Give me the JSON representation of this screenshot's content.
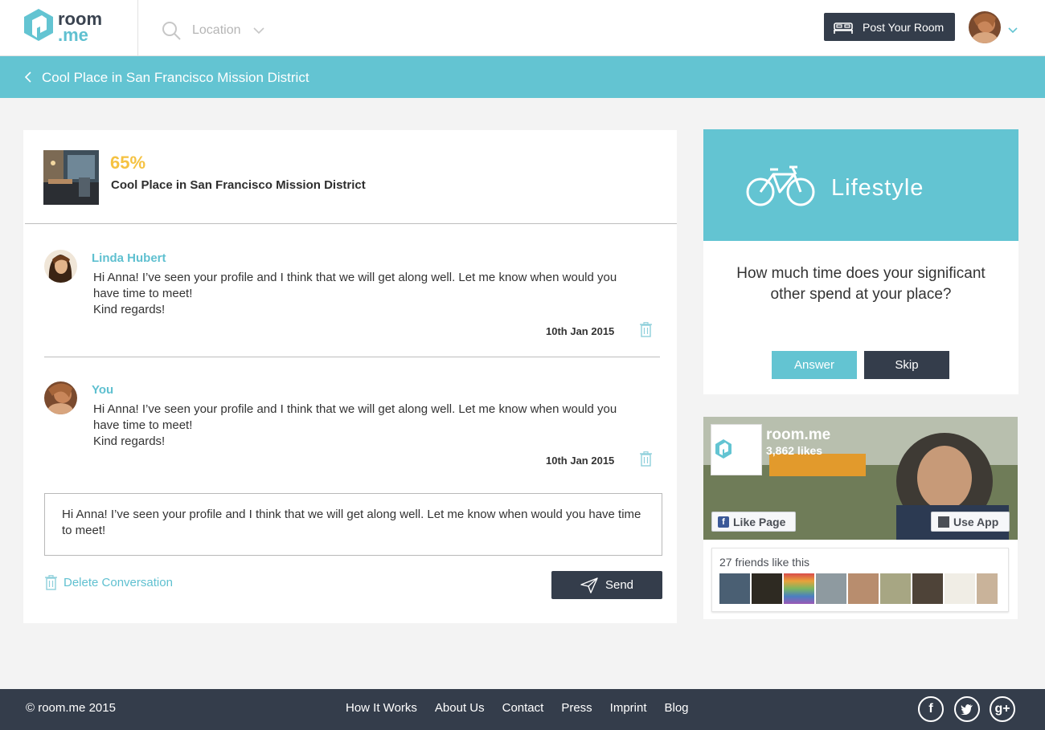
{
  "colors": {
    "accent": "#63c4d2",
    "dark": "#343d4b",
    "percent": "#f5c242",
    "background": "#f3f3f3"
  },
  "header": {
    "logo_top": "room",
    "logo_bottom": ".me",
    "location_placeholder": "Location",
    "post_room_label": "Post Your Room",
    "icons": {
      "search": "search-icon",
      "location_chevron": "chevron-down-icon",
      "post": "bed-icon",
      "avatar_chevron": "chevron-down-icon"
    }
  },
  "subbar": {
    "title": "Cool Place in San Francisco Mission District",
    "back_icon": "chevron-left-icon"
  },
  "room": {
    "percent": "65%",
    "name": "Cool Place in San Francisco Mission District"
  },
  "messages": [
    {
      "author": "Linda Hubert",
      "line1": "Hi Anna! I’ve seen your profile and I think that we will get along well. Let me know when would you",
      "line2": "have time to meet!",
      "line3": "Kind regards!",
      "date": "10th Jan 2015"
    },
    {
      "author": "You",
      "line1": "Hi Anna! I’ve seen your profile and I think that we will get along well. Let me know when would you",
      "line2": "have time to meet!",
      "line3": "Kind regards!",
      "date": "10th Jan 2015"
    }
  ],
  "reply": {
    "text": "Hi Anna! I’ve seen your profile and I think that we will get along well. Let me know when would you have time to meet!"
  },
  "actions": {
    "delete_label": "Delete Conversation",
    "send_label": "Send"
  },
  "lifestyle": {
    "title": "Lifestyle",
    "question": "How much time does your significant other spend at your place?",
    "answer_label": "Answer",
    "skip_label": "Skip",
    "icon": "bicycle-icon"
  },
  "facebook": {
    "page_name": "room.me",
    "likes": "3,862 likes",
    "logo_top": "room",
    "logo_bottom": ".me",
    "like_label": "Like Page",
    "use_app_label": "Use App",
    "friends_label": "27 friends like this",
    "face_colors": [
      "#4a5f73",
      "#2e2a22",
      "#b8646a",
      "#8e9aa0",
      "#b88d6e",
      "#a7a683",
      "#4e4338",
      "#f0ede5",
      "#c9b39a"
    ]
  },
  "footer": {
    "copyright": "© room.me 2015",
    "nav": [
      "How It Works",
      "About Us",
      "Contact",
      "Press",
      "Imprint",
      "Blog"
    ],
    "social_icons": [
      "facebook-icon",
      "twitter-icon",
      "google-plus-icon"
    ]
  }
}
